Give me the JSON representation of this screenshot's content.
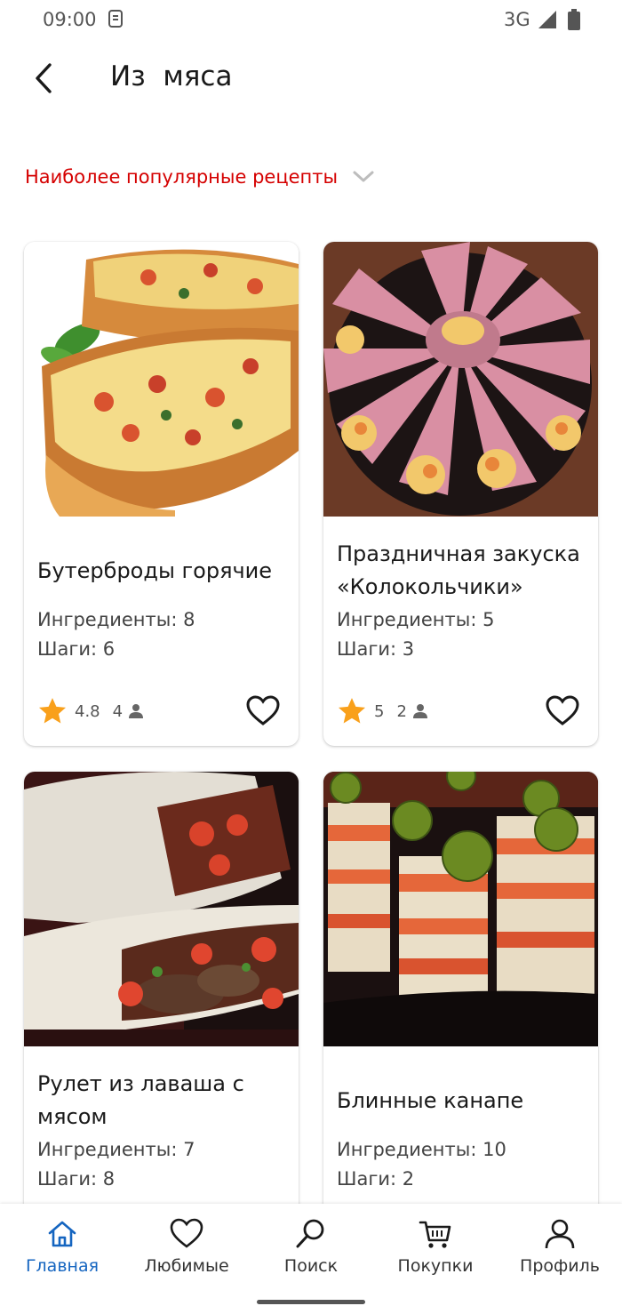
{
  "status_bar": {
    "time": "09:00",
    "network": "3G"
  },
  "header": {
    "title": "Из  мяса"
  },
  "sort": {
    "label": "Наиболее популярные рецепты"
  },
  "colors": {
    "accent_red": "#d50000",
    "nav_active": "#1565c0",
    "star": "#f9a01b"
  },
  "recipes": [
    {
      "name": "Бутерброды горячие",
      "ingredients": "Ингредиенты: 8",
      "steps": "Шаги: 6",
      "rating": "4.8",
      "reviews": "4"
    },
    {
      "name": "Праздничная закуска «Колокольчики»",
      "ingredients": "Ингредиенты: 5",
      "steps": "Шаги: 3",
      "rating": "5",
      "reviews": "2"
    },
    {
      "name": "Рулет из лаваша с мясом",
      "ingredients": "Ингредиенты: 7",
      "steps": "Шаги: 8"
    },
    {
      "name": "Блинные канапе",
      "ingredients": "Ингредиенты: 10",
      "steps": "Шаги: 2"
    }
  ],
  "bottom_nav": [
    {
      "label": "Главная",
      "icon": "home-icon",
      "active": true
    },
    {
      "label": "Любимые",
      "icon": "heart-icon"
    },
    {
      "label": "Поиск",
      "icon": "search-icon"
    },
    {
      "label": "Покупки",
      "icon": "cart-icon"
    },
    {
      "label": "Профиль",
      "icon": "person-icon"
    }
  ]
}
